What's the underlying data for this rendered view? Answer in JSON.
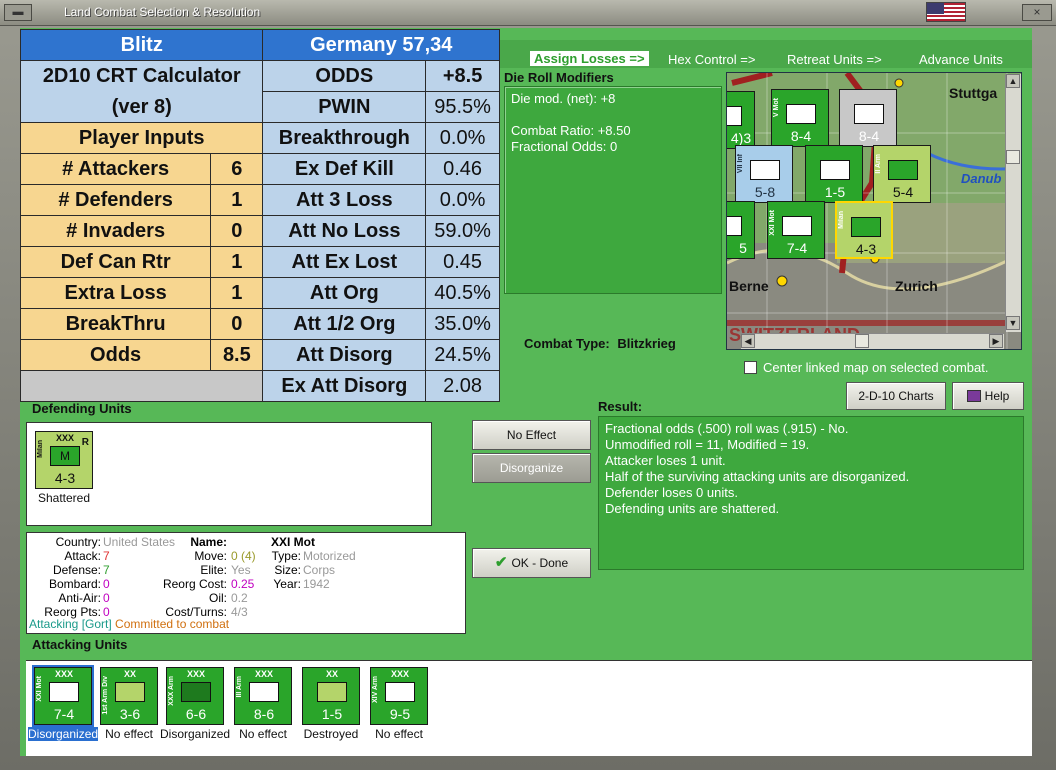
{
  "window": {
    "title": "Land Combat Selection & Resolution",
    "system_button": "▬",
    "close_button": "×"
  },
  "crt": {
    "header_left": "Blitz",
    "header_right": "Germany 57,34",
    "calc_title_1": "2D10 CRT Calculator",
    "calc_title_2": "(ver 8)",
    "player_inputs": "Player Inputs",
    "inputs": [
      {
        "label": "# Attackers",
        "value": "6"
      },
      {
        "label": "# Defenders",
        "value": "1"
      },
      {
        "label": "# Invaders",
        "value": "0"
      },
      {
        "label": "Def Can Rtr",
        "value": "1"
      },
      {
        "label": "Extra Loss",
        "value": "1"
      },
      {
        "label": "BreakThru",
        "value": "0"
      },
      {
        "label": "Odds",
        "value": "8.5"
      }
    ],
    "results": [
      {
        "label": "ODDS",
        "value": "+8.5"
      },
      {
        "label": "PWIN",
        "value": "95.5%"
      },
      {
        "label": "Breakthrough",
        "value": "0.0%"
      },
      {
        "label": "Ex Def Kill",
        "value": "0.46"
      },
      {
        "label": "Att 3 Loss",
        "value": "0.0%"
      },
      {
        "label": "Att No Loss",
        "value": "59.0%"
      },
      {
        "label": "Att Ex Lost",
        "value": "0.45"
      },
      {
        "label": "Att Org",
        "value": "40.5%"
      },
      {
        "label": "Att 1/2 Org",
        "value": "35.0%"
      },
      {
        "label": "Att Disorg",
        "value": "24.5%"
      },
      {
        "label": "Ex Att Disorg",
        "value": "2.08"
      }
    ]
  },
  "tabs": [
    "Assign Losses =>",
    "Hex Control =>",
    "Retreat Units =>",
    "Advance Units"
  ],
  "die_roll": {
    "title": "Die Roll Modifiers",
    "line1": "Die mod. (net): +8",
    "line2": "Combat Ratio: +8.50",
    "line3": "Fractional Odds: 0"
  },
  "map": {
    "labels": [
      "Stuttga",
      "Danub",
      "Berne",
      "Zurich",
      "SWITZERLAND"
    ],
    "counters": [
      {
        "strength": "8-4",
        "side": "V Mot"
      },
      {
        "strength": "8-4",
        "side": ""
      },
      {
        "strength": "5-8",
        "side": "VII Inf"
      },
      {
        "strength": "1-5",
        "side": ""
      },
      {
        "strength": "5-4",
        "side": "II Arm"
      },
      {
        "strength": "7-4",
        "side": "XXI Mot"
      },
      {
        "strength": "4-3",
        "side": "Milan"
      },
      {
        "strength": "4)3",
        "side": ""
      },
      {
        "strength": "5",
        "side": ""
      }
    ]
  },
  "combat_type": {
    "label": "Combat Type:",
    "value": "Blitzkrieg"
  },
  "center_link": "Center linked map on selected combat.",
  "buttons": {
    "charts": "2-D-10 Charts",
    "help": "Help",
    "no_effect": "No Effect",
    "disorganize": "Disorganize",
    "ok_done": "OK - Done"
  },
  "defending": {
    "title": "Defending Units",
    "unit": {
      "size": "XXX",
      "side": "Milan",
      "strength": "4-3",
      "letter": "M",
      "tag": "R",
      "status": "Shattered"
    }
  },
  "result": {
    "title": "Result:",
    "lines": [
      "Fractional odds (.500) roll was (.915)  - No.",
      "Unmodified roll = 11, Modified = 19.",
      "Attacker loses 1 unit.",
      "Half of the surviving attacking units are disorganized.",
      "Defender loses 0 units.",
      "Defending units are shattered."
    ]
  },
  "unit_info": {
    "country_label": "Country:",
    "country": "United States",
    "attack_label": "Attack:",
    "attack": "7",
    "defense_label": "Defense:",
    "defense": "7",
    "bombard_label": "Bombard:",
    "bombard": "0",
    "antiair_label": "Anti-Air:",
    "antiair": "0",
    "reorg_pts_label": "Reorg Pts:",
    "reorg_pts": "0",
    "name_label": "Name:",
    "name": "XXI Mot",
    "move_label": "Move:",
    "move": "0 (4)",
    "type_label": "Type:",
    "type": "Motorized",
    "elite_label": "Elite:",
    "elite": "Yes",
    "size_label": "Size:",
    "size": "Corps",
    "reorg_cost_label": "Reorg Cost:",
    "reorg_cost": "0.25",
    "year_label": "Year:",
    "year": "1942",
    "oil_label": "Oil:",
    "oil": "0.2",
    "cost_label": "Cost/Turns:",
    "cost": "4/3",
    "attacking_note": "Attacking [Gort]",
    "committed_note": "Committed to combat"
  },
  "attacking": {
    "title": "Attacking Units",
    "units": [
      {
        "size": "XXX",
        "side": "XXI Mot",
        "strength": "7-4",
        "status": "Disorganized",
        "color": "#2aa52a",
        "nato": "mot",
        "selected": true
      },
      {
        "size": "XX",
        "side": "1st Arm Div",
        "strength": "3-6",
        "status": "No effect",
        "color": "#2aa52a",
        "nato": "arm",
        "selected": false
      },
      {
        "size": "XXX",
        "side": "XXX Arm",
        "strength": "6-6",
        "status": "Disorganized",
        "color": "#2aa52a",
        "nato": "arm",
        "selected": false
      },
      {
        "size": "XXX",
        "side": "III Arm",
        "strength": "8-6",
        "status": "No effect",
        "color": "#2aa52a",
        "nato": "arm",
        "selected": false
      },
      {
        "size": "XX",
        "side": "",
        "strength": "1-5",
        "status": "Destroyed",
        "color": "#2aa52a",
        "nato": "inf",
        "selected": false
      },
      {
        "size": "XXX",
        "side": "XIV Arm",
        "strength": "9-5",
        "status": "No effect",
        "color": "#2aa52a",
        "nato": "arm",
        "selected": false
      }
    ]
  }
}
